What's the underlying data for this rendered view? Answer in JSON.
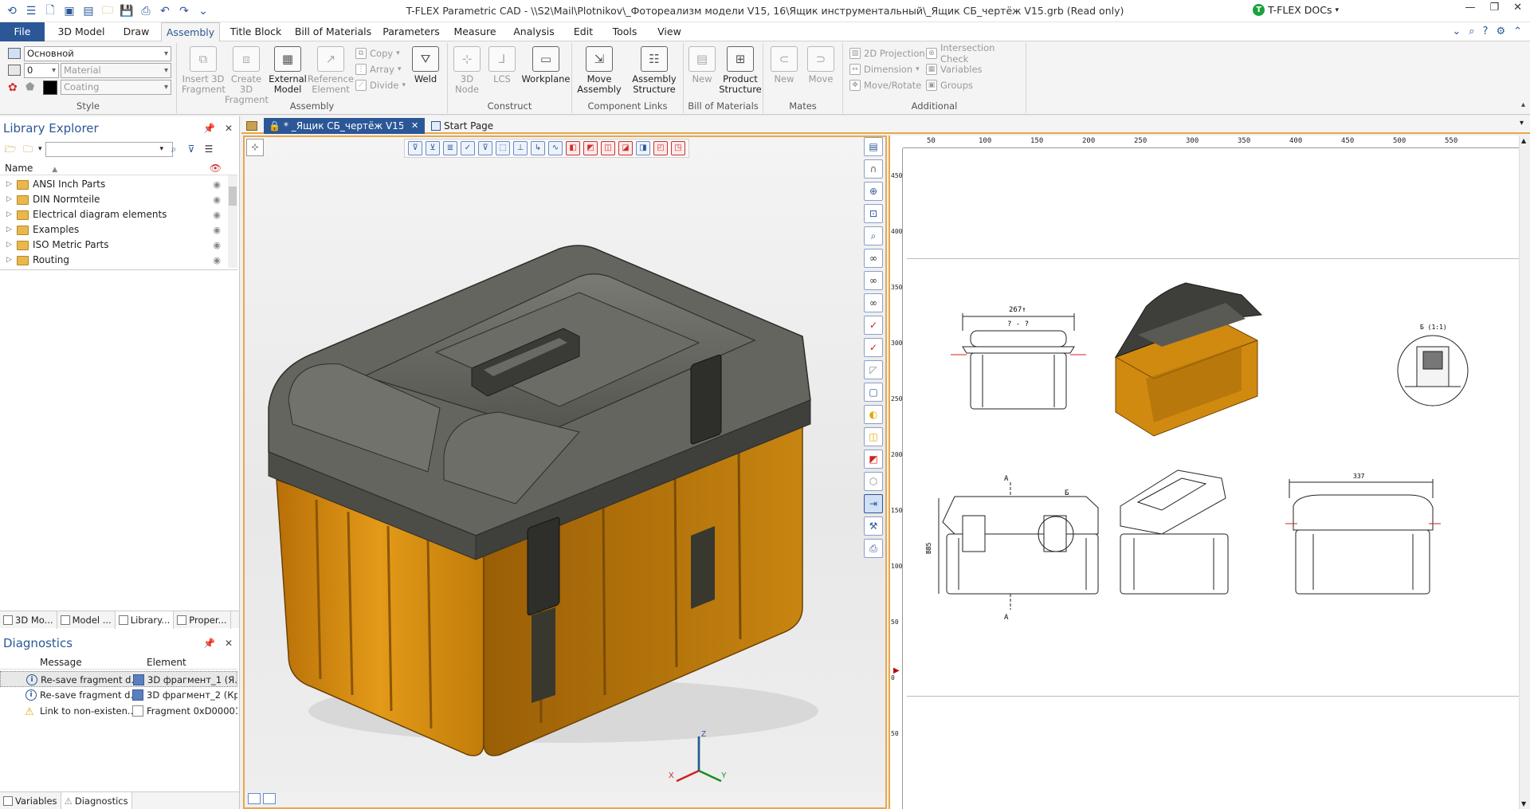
{
  "app": {
    "window_title": "T-FLEX Parametric CAD - \\\\S2\\Mail\\Plotnikov\\_Фотореализм модели V15, 16\\Ящик инструментальный\\_Ящик СБ_чертёж V15.grb (Read only)",
    "docs_label": "T-FLEX DOCs"
  },
  "menu": {
    "tabs": [
      "File",
      "3D Model",
      "Draw",
      "Assembly",
      "Title Block",
      "Bill of Materials",
      "Parameters",
      "Measure",
      "Analysis",
      "Edit",
      "Tools",
      "View"
    ],
    "active": "Assembly"
  },
  "ribbon": {
    "style": {
      "label": "Style",
      "layer": "Основной",
      "level": "0",
      "material": "Material",
      "coating": "Coating"
    },
    "assembly": {
      "label": "Assembly",
      "insert_3d_fragment": "Insert 3D Fragment",
      "create_3d_fragment": "Create 3D Fragment",
      "external_model": "External Model",
      "reference_element": "Reference Element",
      "copy": "Copy",
      "array": "Array",
      "divide": "Divide",
      "weld": "Weld"
    },
    "construct": {
      "label": "Construct",
      "node_3d": "3D Node",
      "lcs": "LCS",
      "workplane": "Workplane"
    },
    "component_links": {
      "label": "Component Links",
      "move_assembly": "Move Assembly",
      "assembly_structure": "Assembly Structure"
    },
    "bill_of_materials": {
      "label": "Bill of Materials",
      "new": "New",
      "product_structure": "Product Structure"
    },
    "mates": {
      "label": "Mates",
      "new": "New",
      "move": "Move"
    },
    "additional": {
      "label": "Additional",
      "projection_2d": "2D Projection",
      "intersection_check": "Intersection Check",
      "dimension": "Dimension",
      "variables": "Variables",
      "move_rotate": "Move/Rotate",
      "groups": "Groups"
    }
  },
  "library_explorer": {
    "title": "Library Explorer",
    "column_name": "Name",
    "items": [
      "ANSI Inch Parts",
      "DIN Normteile",
      "Electrical diagram elements",
      "Examples",
      "ISO Metric Parts",
      "Routing"
    ],
    "bottom_tabs": [
      "3D Mo...",
      "Model ...",
      "Library...",
      "Proper..."
    ]
  },
  "diagnostics": {
    "title": "Diagnostics",
    "col_message": "Message",
    "col_element": "Element",
    "rows": [
      {
        "type": "info",
        "message": "Re-save fragment d...",
        "element": "3D фрагмент_1 (Я..."
      },
      {
        "type": "info",
        "message": "Re-save fragment d...",
        "element": "3D фрагмент_2 (Кр..."
      },
      {
        "type": "warning",
        "message": "Link to non-existen...",
        "element": "Fragment 0xD00001..."
      }
    ],
    "bottom_tabs": [
      "Variables",
      "Diagnostics"
    ]
  },
  "documents": {
    "tabs": [
      {
        "label": "* _Ящик СБ_чертёж V15.g...",
        "active": true
      },
      {
        "label": "Start Page",
        "active": false
      }
    ]
  },
  "viewport": {
    "axes": {
      "x": "X",
      "y": "Y",
      "z": "Z"
    }
  },
  "drawing": {
    "ruler_h": [
      "50",
      "100",
      "150",
      "200",
      "250",
      "300",
      "350",
      "400",
      "450",
      "500",
      "550"
    ],
    "ruler_v": [
      "450",
      "400",
      "350",
      "300",
      "250",
      "200",
      "150",
      "100",
      "50",
      "0",
      "50"
    ],
    "dims": {
      "top_width": "267↑",
      "top_marks": "? - ?",
      "section_a": "A",
      "section_b": "Б",
      "height": "BB5",
      "view_b": "Б (1:1)",
      "right_width": "337"
    }
  },
  "colors": {
    "accent": "#2b5797",
    "orange": "#d08a10",
    "lid": "#5a5a55",
    "frame": "#e8a848"
  }
}
